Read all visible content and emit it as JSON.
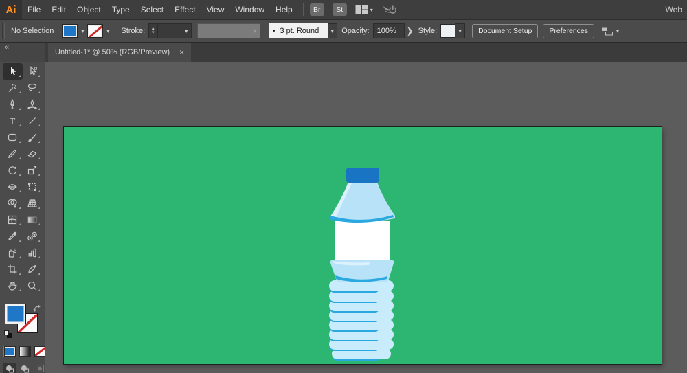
{
  "menu_bar": {
    "logo": "Ai",
    "items": [
      "File",
      "Edit",
      "Object",
      "Type",
      "Select",
      "Effect",
      "View",
      "Window",
      "Help"
    ],
    "bridge": "Br",
    "stock": "St",
    "workspace": "Web"
  },
  "control_bar": {
    "no_selection": "No Selection",
    "stroke_label": "Stroke:",
    "brush_dot": "•",
    "brush_value": "3 pt. Round",
    "opacity_label": "Opacity:",
    "opacity_value": "100%",
    "style_label": "Style:",
    "document_setup": "Document Setup",
    "preferences": "Preferences"
  },
  "tab_bar": {
    "collapse": "«",
    "title": "Untitled-1* @ 50% (RGB/Preview)",
    "close": "×"
  },
  "toolbar": {
    "tools": [
      "selection",
      "direct-selection",
      "magic-wand",
      "lasso",
      "pen",
      "curvature",
      "type",
      "line-segment",
      "rectangle",
      "paintbrush",
      "shaper",
      "eraser",
      "rotate",
      "scale",
      "width",
      "free-transform",
      "shape-builder",
      "perspective-grid",
      "mesh",
      "gradient",
      "eyedropper",
      "blend",
      "symbol-sprayer",
      "column-graph",
      "artboard",
      "slice",
      "hand",
      "zoom"
    ]
  },
  "colors": {
    "fill_blue": "#1f77c8",
    "slash_red": "#d42a2a",
    "artboard_green": "#2db671",
    "cap_blue": "#1a74c4",
    "bottle_blue": "#b7e2f8",
    "bottle_light": "#ddf1fd",
    "bottle_ring": "#c9ecfc",
    "accent_blue": "#2aa9e0",
    "label_white": "#ffffff"
  }
}
